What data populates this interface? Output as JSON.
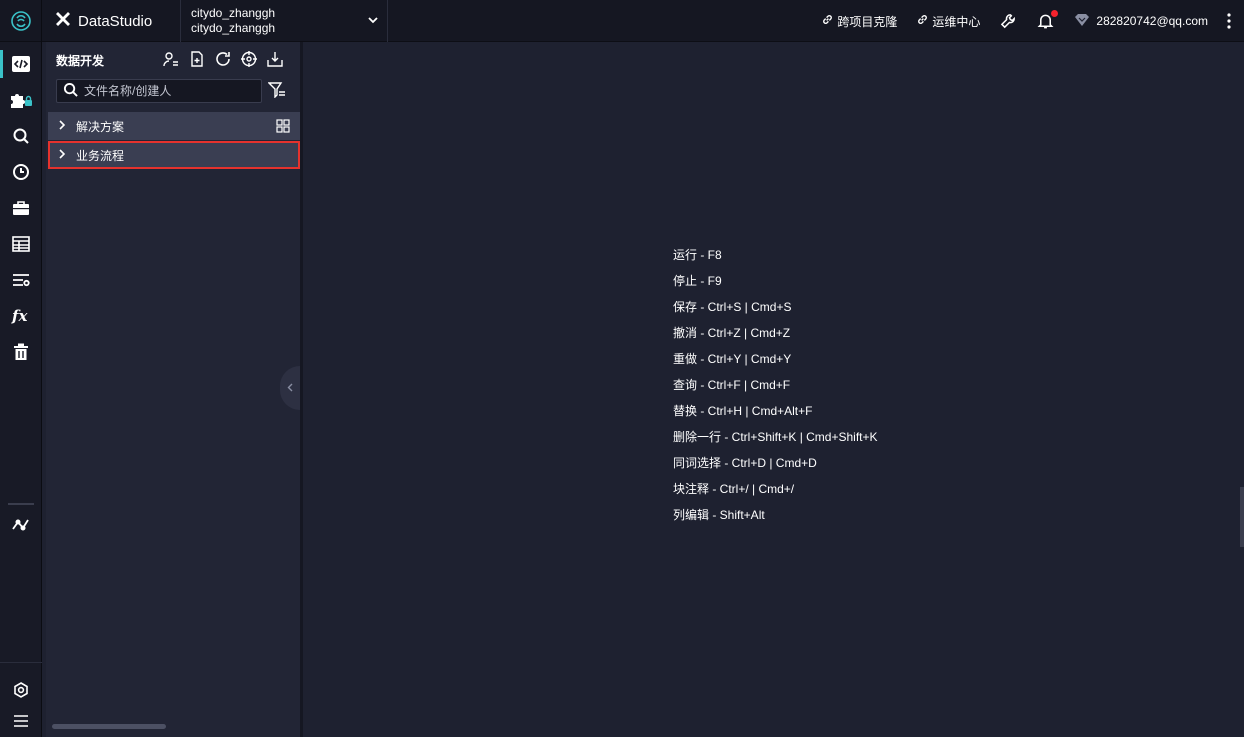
{
  "header": {
    "app_name": "DataStudio",
    "project": {
      "line1": "citydo_zhanggh",
      "line2": "citydo_zhanggh"
    },
    "links": [
      {
        "label": "跨项目克隆",
        "icon": "link-icon"
      },
      {
        "label": "运维中心",
        "icon": "link-icon"
      }
    ],
    "user_email": "282820742@qq.com"
  },
  "rail": {
    "items": [
      "code-icon",
      "puzzle-icon",
      "search-icon",
      "clock-icon",
      "briefcase-icon",
      "table-icon",
      "list-icon",
      "function-icon",
      "trash-icon",
      "workflow-icon",
      "settings-icon",
      "menu-icon"
    ],
    "active": "code-icon"
  },
  "explorer": {
    "title": "数据开发",
    "search_placeholder": "文件名称/创建人",
    "tree": [
      {
        "label": "解决方案"
      },
      {
        "label": "业务流程"
      }
    ]
  },
  "shortcuts": [
    "运行 - F8",
    "停止 - F9",
    "保存 - Ctrl+S | Cmd+S",
    "撤消 - Ctrl+Z | Cmd+Z",
    "重做 - Ctrl+Y | Cmd+Y",
    "查询 - Ctrl+F | Cmd+F",
    "替换 - Ctrl+H | Cmd+Alt+F",
    "删除一行 - Ctrl+Shift+K | Cmd+Shift+K",
    "同词选择 - Ctrl+D | Cmd+D",
    "块注释 - Ctrl+/ | Cmd+/",
    "列编辑 - Shift+Alt"
  ],
  "colors": {
    "accent": "#3ac2c8",
    "highlight": "#e5322d",
    "notification": "#f5222d"
  }
}
